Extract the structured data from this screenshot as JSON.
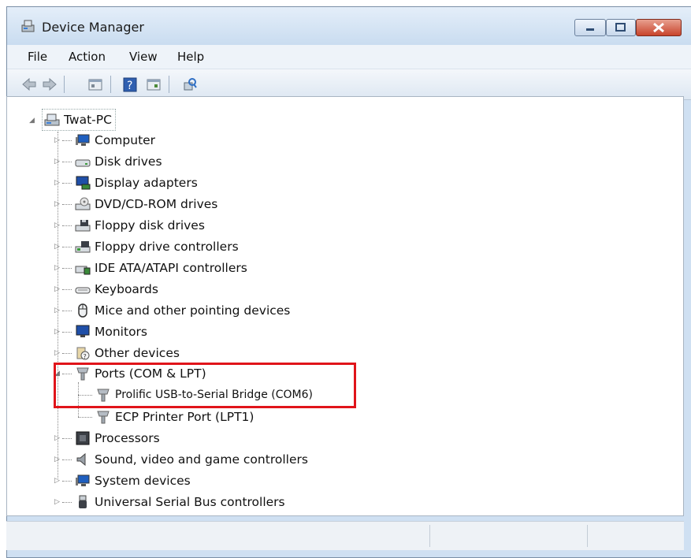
{
  "window": {
    "title": "Device Manager"
  },
  "menu": [
    "File",
    "Action",
    "View",
    "Help"
  ],
  "toolbar": [
    "back-icon",
    "forward-icon",
    "properties-icon",
    "help-icon",
    "show-hidden-icon",
    "scan-hardware-icon"
  ],
  "tree": {
    "root": "Twat-PC",
    "categories": [
      {
        "label": "Computer",
        "icon": "computer-icon"
      },
      {
        "label": "Disk drives",
        "icon": "disk-drive-icon"
      },
      {
        "label": "Display adapters",
        "icon": "display-adapter-icon"
      },
      {
        "label": "DVD/CD-ROM drives",
        "icon": "dvd-drive-icon"
      },
      {
        "label": "Floppy disk drives",
        "icon": "floppy-drive-icon"
      },
      {
        "label": "Floppy drive controllers",
        "icon": "floppy-controller-icon"
      },
      {
        "label": "IDE ATA/ATAPI controllers",
        "icon": "ide-controller-icon"
      },
      {
        "label": "Keyboards",
        "icon": "keyboard-icon"
      },
      {
        "label": "Mice and other pointing devices",
        "icon": "mouse-icon"
      },
      {
        "label": "Monitors",
        "icon": "monitor-icon"
      },
      {
        "label": "Other devices",
        "icon": "unknown-device-icon"
      },
      {
        "label": "Ports (COM & LPT)",
        "icon": "port-icon",
        "expanded": true,
        "children": [
          {
            "label": "Prolific USB-to-Serial Bridge (COM6)",
            "icon": "port-icon"
          },
          {
            "label": "ECP Printer Port (LPT1)",
            "icon": "port-icon"
          }
        ]
      },
      {
        "label": "Processors",
        "icon": "processor-icon"
      },
      {
        "label": "Sound, video and game controllers",
        "icon": "speaker-icon"
      },
      {
        "label": "System devices",
        "icon": "system-device-icon"
      },
      {
        "label": "Universal Serial Bus controllers",
        "icon": "usb-icon"
      }
    ]
  },
  "highlight_color": "#e0141a"
}
